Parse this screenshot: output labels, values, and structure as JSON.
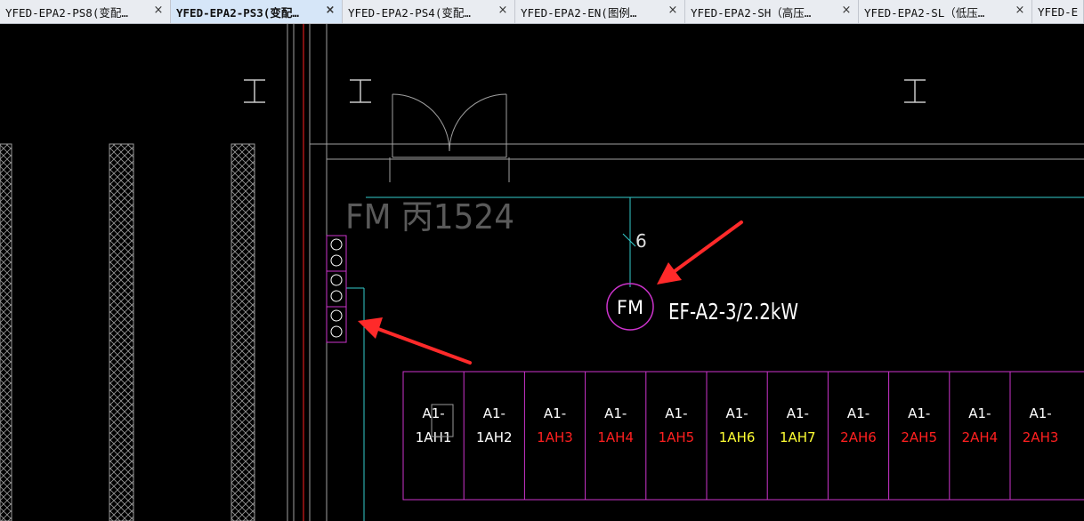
{
  "tabs": [
    {
      "label": "YFED-EPA2-PS8(变配…",
      "close": "×",
      "active": false
    },
    {
      "label": "YFED-EPA2-PS3(变配…",
      "close": "×",
      "active": true
    },
    {
      "label": "YFED-EPA2-PS4(变配…",
      "close": "×",
      "active": false
    },
    {
      "label": "YFED-EPA2-EN(图例…",
      "close": "×",
      "active": false
    },
    {
      "label": "YFED-EPA2-SH（高压…",
      "close": "×",
      "active": false
    },
    {
      "label": "YFED-EPA2-SL（低压…",
      "close": "×",
      "active": false
    },
    {
      "label": "YFED-E",
      "close": "",
      "active": false
    }
  ],
  "drawing": {
    "room_label": "FM 丙1524",
    "column_symbol": "工",
    "fan_symbol": "FM",
    "fan_label": "EF-A2-3/2.2kW",
    "wire_count": "6",
    "panels": [
      {
        "top": "A1-",
        "bottom": "1AH1",
        "color": "#ffffff"
      },
      {
        "top": "A1-",
        "bottom": "1AH2",
        "color": "#ffffff"
      },
      {
        "top": "A1-",
        "bottom": "1AH3",
        "color": "#ff2020"
      },
      {
        "top": "A1-",
        "bottom": "1AH4",
        "color": "#ff2020"
      },
      {
        "top": "A1-",
        "bottom": "1AH5",
        "color": "#ff2020"
      },
      {
        "top": "A1-",
        "bottom": "1AH6",
        "color": "#ffff33"
      },
      {
        "top": "A1-",
        "bottom": "1AH7",
        "color": "#ffff33"
      },
      {
        "top": "A1-",
        "bottom": "2AH6",
        "color": "#ff2020"
      },
      {
        "top": "A1-",
        "bottom": "2AH5",
        "color": "#ff2020"
      },
      {
        "top": "A1-",
        "bottom": "2AH4",
        "color": "#ff2020"
      },
      {
        "top": "A1-",
        "bottom": "2AH3",
        "color": "#ff2020"
      }
    ],
    "colors": {
      "background": "#000000",
      "magenta": "#cc33cc",
      "cyan": "#33cccc",
      "grey": "#a0a0a0",
      "red": "#ff2020",
      "yellow": "#ffff33",
      "arrow": "#ff2a2a"
    }
  }
}
